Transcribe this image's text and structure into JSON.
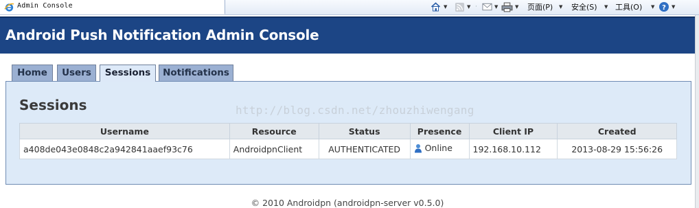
{
  "browser": {
    "tab_title": "Admin Console",
    "page_menu": "页面(P)",
    "safety_menu": "安全(S)",
    "tools_menu": "工具(O)",
    "icons": [
      "home-icon",
      "feeds-icon",
      "mail-icon",
      "print-icon",
      "help-icon"
    ]
  },
  "header": {
    "title": "Android Push Notification Admin Console"
  },
  "tabs": [
    {
      "label": "Home"
    },
    {
      "label": "Users"
    },
    {
      "label": "Sessions"
    },
    {
      "label": "Notifications"
    }
  ],
  "active_tab": "Sessions",
  "page": {
    "title": "Sessions",
    "watermark": "http://blog.csdn.net/zhouzhiwengang"
  },
  "table": {
    "columns": [
      "Username",
      "Resource",
      "Status",
      "Presence",
      "Client IP",
      "Created"
    ],
    "rows": [
      {
        "username": "a408de043e0848c2a942841aaef93c76",
        "resource": "AndroidpnClient",
        "status": "AUTHENTICATED",
        "presence": "Online",
        "client_ip": "192.168.10.112",
        "created": "2013-08-29 15:56:26"
      }
    ]
  },
  "footer": {
    "text": "© 2010 Androidpn (androidpn-server v0.5.0)"
  },
  "colors": {
    "banner": "#1c4585",
    "panel": "#ddeaf8",
    "tab": "#9bb0d2",
    "tab_active": "#dde9f8"
  }
}
